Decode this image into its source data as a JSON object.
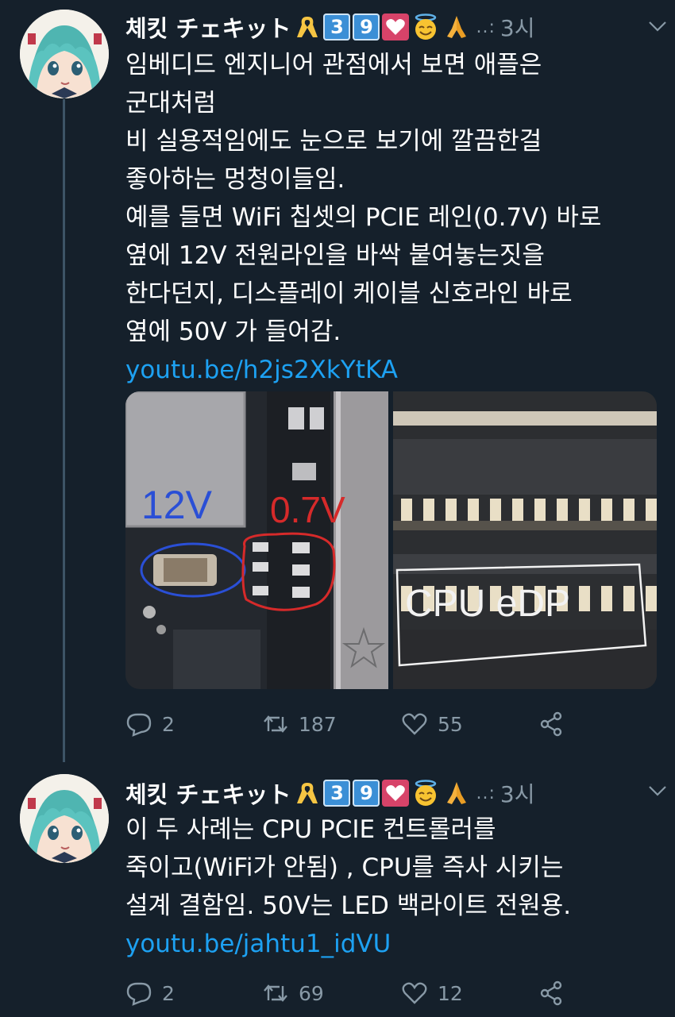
{
  "tweets": [
    {
      "author": "체킷 チェキット",
      "badge_numbers": [
        "3",
        "9"
      ],
      "handle": "..:",
      "time": "3시",
      "lines": [
        "임베디드 엔지니어 관점에서 보면 애플은",
        "군대처럼",
        "비 실용적임에도 눈으로 보기에 깔끔한걸",
        "좋아하는 멍청이들임.",
        "예를 들면 WiFi 칩셋의 PCIE 레인(0.7V) 바로",
        "옆에 12V 전원라인을 바싹 붙여놓는짓을",
        "한다던지, 디스플레이 케이블 신호라인 바로",
        "옆에 50V 가 들어감."
      ],
      "link": "youtu.be/h2js2XkYtKA",
      "media_annotations": {
        "left_blue": "12V",
        "left_red": "0.7V",
        "right_white": "CPU eDP"
      },
      "replies": "2",
      "retweets": "187",
      "likes": "55"
    },
    {
      "author": "체킷 チェキット",
      "badge_numbers": [
        "3",
        "9"
      ],
      "handle": "..:",
      "time": "3시",
      "lines": [
        "이 두 사례는 CPU PCIE 컨트롤러를",
        "죽이고(WiFi가 안됨) , CPU를 즉사 시키는",
        "설계 결함임. 50V는 LED 백라이트 전원용."
      ],
      "link": "youtu.be/jahtu1_idVU",
      "replies": "2",
      "retweets": "69",
      "likes": "12"
    }
  ],
  "colors": {
    "background": "#15202b",
    "text": "#ffffff",
    "secondary": "#8899a6",
    "link": "#1da1f2",
    "thread_line": "#3d5466"
  },
  "icons": [
    "ribbon-icon",
    "heart-icon",
    "halo-face-icon",
    "praying-hands-icon",
    "chevron-down-icon",
    "reply-icon",
    "retweet-icon",
    "like-icon",
    "share-icon"
  ]
}
